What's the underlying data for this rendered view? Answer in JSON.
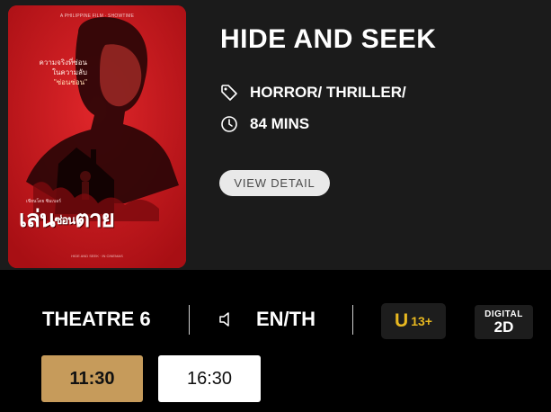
{
  "poster": {
    "credit_line": "A PHILIPPINE FILM · SHOWTIME",
    "tagline_1": "ความจริงที่ซ่อน",
    "tagline_2": "ในความลับ",
    "tagline_3": "\"ซ่อนซ่อน\"",
    "sub_line": "เขียนโดย ซิมเบอร์",
    "title_thai_big_1": "เล่น",
    "title_thai_small": "ซ่อน",
    "title_thai_big_2": "ตาย",
    "footer": "HIDE AND SEEK · IN CINEMAS"
  },
  "movie": {
    "title": "HIDE AND SEEK",
    "genre": "HORROR/ THRILLER/",
    "duration": "84 MINS",
    "view_detail_label": "VIEW DETAIL"
  },
  "session": {
    "theatre": "THEATRE 6",
    "sound": "EN/TH",
    "rating_letter": "U",
    "rating_age": "13+",
    "format_top": "DIGITAL",
    "format_main": "2D"
  },
  "showtimes": [
    "11:30",
    "16:30"
  ],
  "colors": {
    "active_showtime": "#c69b5b",
    "rating_text": "#e8b820",
    "poster_red": "#c8161c"
  },
  "icons": {
    "genre": "tag-icon",
    "duration": "clock-icon",
    "sound": "speaker-icon"
  }
}
